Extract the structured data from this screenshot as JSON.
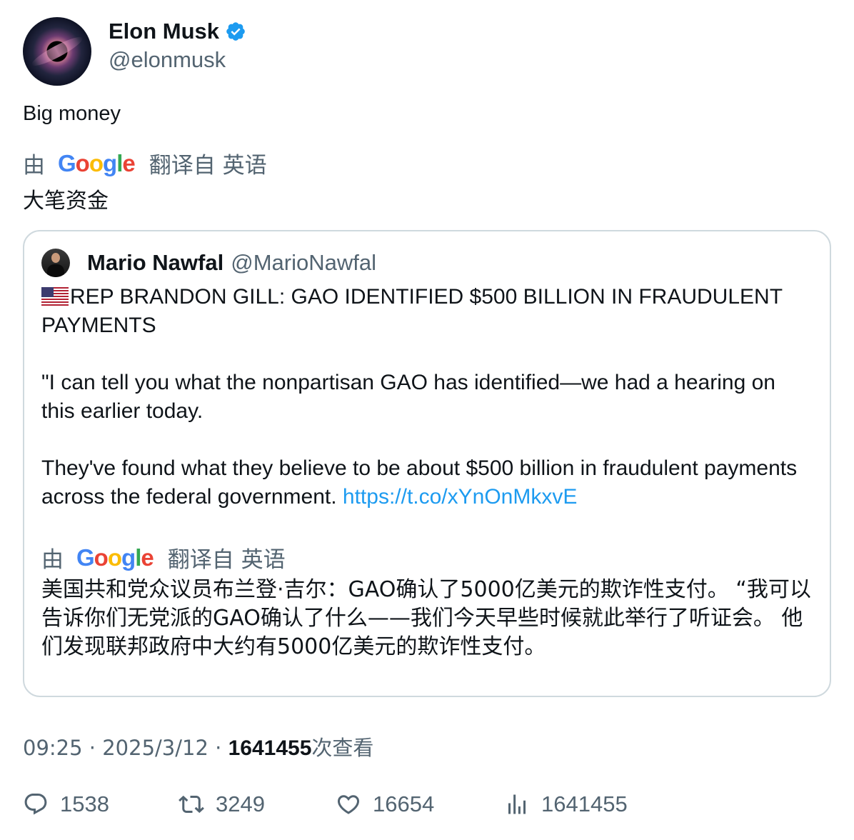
{
  "author": {
    "display_name": "Elon Musk",
    "handle": "@elonmusk"
  },
  "tweet": {
    "text": "Big money",
    "translation": {
      "by": "由",
      "google": "Google",
      "from": "翻译自 英语",
      "text": "大笔资金"
    }
  },
  "quote": {
    "display_name": "Mario Nawfal",
    "handle": "@MarioNawfal",
    "headline": "REP BRANDON GILL: GAO IDENTIFIED $500 BILLION IN FRAUDULENT PAYMENTS",
    "paragraph1": "\"I can tell you what the nonpartisan GAO has identified—we had a hearing on this earlier today.",
    "paragraph2": "They've found what they believe to be about $500 billion in fraudulent payments across the federal government.",
    "link": "https://t.co/xYnOnMkxvE",
    "translation": {
      "by": "由",
      "google": "Google",
      "from": "翻译自 英语",
      "text": "美国共和党众议员布兰登·吉尔：GAO确认了5000亿美元的欺诈性支付。 “我可以告诉你们无党派的GAO确认了什么——我们今天早些时候就此举行了听证会。 他们发现联邦政府中大约有5000亿美元的欺诈性支付。"
    }
  },
  "meta": {
    "time": "09:25",
    "separator": "·",
    "date": "2025/3/12",
    "views": "1641455",
    "views_suffix": "次查看"
  },
  "actions": {
    "replies": "1538",
    "retweets": "3249",
    "likes": "16654",
    "views": "1641455"
  },
  "colors": {
    "accent": "#1d9bf0",
    "secondary_text": "#536471",
    "border": "#cfd9de"
  }
}
